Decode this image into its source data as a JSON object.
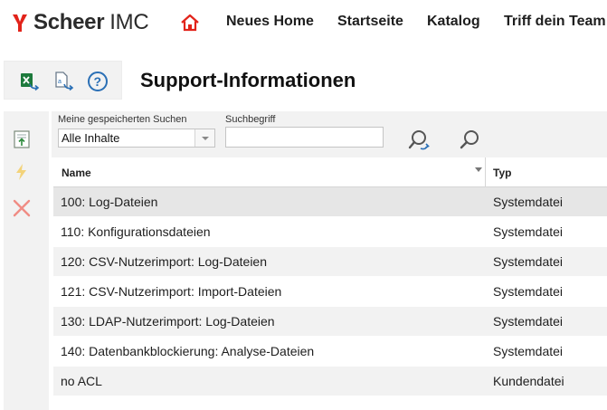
{
  "brand": {
    "name_strong": "Scheer",
    "name_light": "IMC",
    "color": "#e2231a"
  },
  "nav": {
    "home_icon": "home-icon",
    "items": [
      {
        "label": "Neues Home"
      },
      {
        "label": "Startseite"
      },
      {
        "label": "Katalog"
      },
      {
        "label": "Triff dein Team"
      }
    ]
  },
  "toolbar": {
    "icons": [
      "excel-export-icon",
      "document-export-icon",
      "help-icon"
    ]
  },
  "page": {
    "title": "Support-Informationen"
  },
  "side_actions": {
    "icons": [
      "upload-icon",
      "lightning-icon",
      "delete-icon"
    ]
  },
  "search": {
    "saved_label": "Meine gespeicherten Suchen",
    "saved_value": "Alle Inhalte",
    "term_label": "Suchbegriff",
    "term_value": "",
    "icons": [
      "reset-search-icon",
      "search-icon"
    ]
  },
  "table": {
    "columns": {
      "name": "Name",
      "type": "Typ"
    },
    "rows": [
      {
        "name": "100: Log-Dateien",
        "type": "Systemdatei"
      },
      {
        "name": "110: Konfigurationsdateien",
        "type": "Systemdatei"
      },
      {
        "name": "120: CSV-Nutzerimport: Log-Dateien",
        "type": "Systemdatei"
      },
      {
        "name": "121: CSV-Nutzerimport: Import-Dateien",
        "type": "Systemdatei"
      },
      {
        "name": "130: LDAP-Nutzerimport: Log-Dateien",
        "type": "Systemdatei"
      },
      {
        "name": "140: Datenbankblockierung: Analyse-Dateien",
        "type": "Systemdatei"
      },
      {
        "name": "no ACL",
        "type": "Kundendatei"
      }
    ]
  },
  "colors": {
    "accent": "#e2231a",
    "panel": "#f2f2f2",
    "icon_blue": "#2a6fb5",
    "excel_green": "#1d7a3c"
  }
}
